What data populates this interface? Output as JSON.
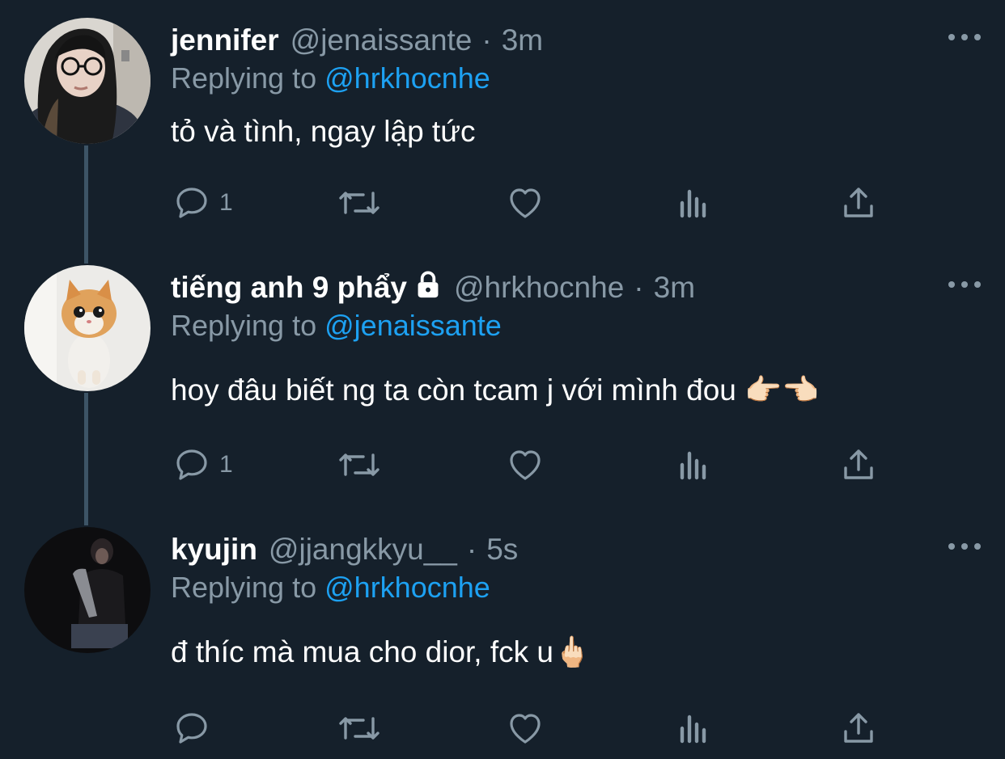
{
  "tweets": [
    {
      "name": "jennifer",
      "handle": "@jenaissante",
      "time": "3m",
      "replying_label": "Replying to",
      "replying_to": "@hrkhocnhe",
      "text": "tỏ và tình, ngay lập tức",
      "reply_count": "1",
      "avatar": "girl-with-glasses-avatar"
    },
    {
      "name": "tiếng anh 9 phẩy",
      "locked": true,
      "handle": "@hrkhocnhe",
      "time": "3m",
      "replying_label": "Replying to",
      "replying_to": "@jenaissante",
      "text": "hoy đâu biết ng ta còn tcam j với mình đou 👉🏻👈🏻",
      "reply_count": "1",
      "avatar": "kitten-avatar"
    },
    {
      "name": "kyujin",
      "handle": "@jjangkkyu__",
      "time": "5s",
      "replying_label": "Replying to",
      "replying_to": "@hrkhocnhe",
      "text": "đ thíc mà mua cho dior, fck u🖕🏻",
      "reply_count": "",
      "avatar": "dark-photo-avatar"
    }
  ],
  "colors": {
    "background": "#15202b",
    "secondary_text": "#8899a6",
    "mention": "#1da1f2",
    "thread_line": "#3d5466"
  },
  "icons": [
    "reply-icon",
    "retweet-icon",
    "like-icon",
    "analytics-icon",
    "share-icon",
    "more-icon",
    "lock-icon"
  ]
}
